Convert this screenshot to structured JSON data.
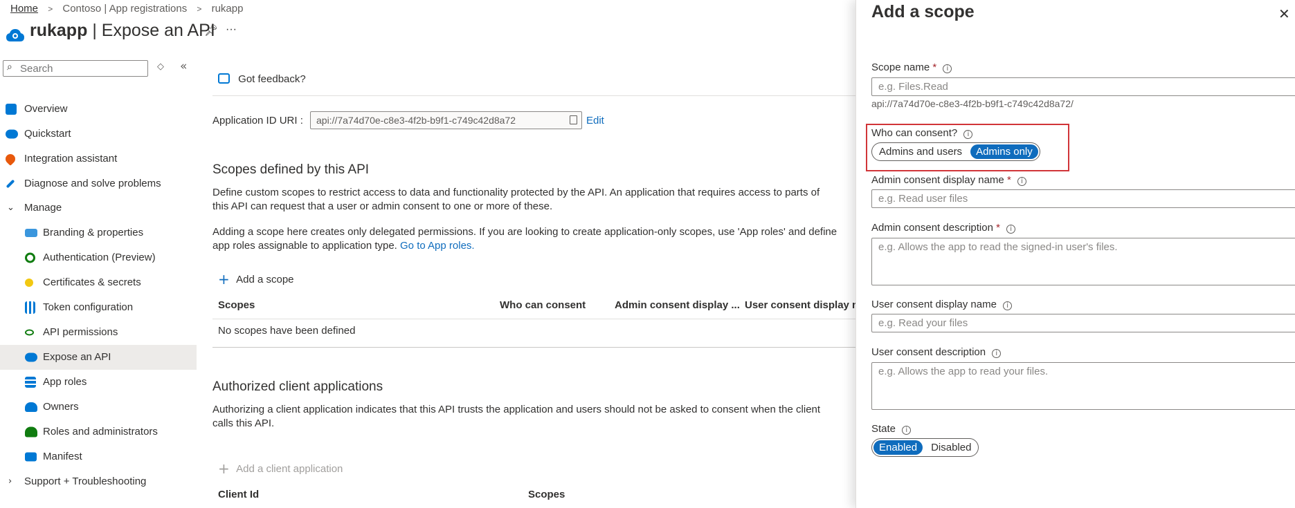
{
  "breadcrumb": {
    "home": "Home",
    "sep": ">",
    "parent": "Contoso | App registrations",
    "current": "rukapp"
  },
  "page": {
    "app_name": "rukapp",
    "divider": "|",
    "title": "Expose an API",
    "more": "···"
  },
  "sidebar": {
    "search_placeholder": "Search",
    "items": [
      {
        "label": "Overview",
        "icon": "overview-icon",
        "color": "#0078d4"
      },
      {
        "label": "Quickstart",
        "icon": "cloud-icon",
        "color": "#0078d4"
      },
      {
        "label": "Integration assistant",
        "icon": "rocket-icon",
        "color": "#e8590c"
      },
      {
        "label": "Diagnose and solve problems",
        "icon": "wrench-icon",
        "color": "#0078d4"
      },
      {
        "label": "Manage",
        "icon": "chevron-down-icon"
      },
      {
        "label": "Branding & properties",
        "icon": "branding-icon",
        "color": "#3a96dd"
      },
      {
        "label": "Authentication (Preview)",
        "icon": "authentication-icon",
        "color": "#107c10"
      },
      {
        "label": "Certificates & secrets",
        "icon": "key-icon",
        "color": "#f2c811"
      },
      {
        "label": "Token configuration",
        "icon": "token-icon",
        "color": "#0078d4"
      },
      {
        "label": "API permissions",
        "icon": "api-permissions-icon",
        "color": "#107c10"
      },
      {
        "label": "Expose an API",
        "icon": "cloud-gear-icon",
        "color": "#0078d4"
      },
      {
        "label": "App roles",
        "icon": "grid-icon",
        "color": "#0078d4"
      },
      {
        "label": "Owners",
        "icon": "people-icon",
        "color": "#0078d4"
      },
      {
        "label": "Roles and administrators",
        "icon": "user-role-icon",
        "color": "#107c10"
      },
      {
        "label": "Manifest",
        "icon": "manifest-icon",
        "color": "#0078d4"
      },
      {
        "label": "Support + Troubleshooting",
        "icon": "chevron-right-icon"
      }
    ]
  },
  "main": {
    "feedback": "Got feedback?",
    "app_id_label": "Application ID URI :",
    "app_id_value": "api://7a74d70e-c8e3-4f2b-b9f1-c749c42d8a72",
    "edit": "Edit",
    "scopes_title": "Scopes defined by this API",
    "scopes_desc": "Define custom scopes to restrict access to data and functionality protected by the API. An application that requires access to parts of this API can request that a user or admin consent to one or more of these.",
    "scopes_note": "Adding a scope here creates only delegated permissions. If you are looking to create application-only scopes, use 'App roles' and define app roles assignable to application type.",
    "go_to_app_roles": "Go to App roles.",
    "add_scope": "Add a scope",
    "columns": [
      "Scopes",
      "Who can consent",
      "Admin consent display ...",
      "User consent display na..."
    ],
    "empty_scopes": "No scopes have been defined",
    "clients_title": "Authorized client applications",
    "clients_desc": "Authorizing a client application indicates that this API trusts the application and users should not be asked to consent when the client calls this API.",
    "add_client": "Add a client application",
    "client_columns": [
      "Client Id",
      "Scopes"
    ]
  },
  "panel": {
    "title": "Add a scope",
    "scope_name_label": "Scope name",
    "scope_name_placeholder": "e.g. Files.Read",
    "scope_uri": "api://7a74d70e-c8e3-4f2b-b9f1-c749c42d8a72/",
    "consent_label": "Who can consent?",
    "consent_options": [
      "Admins and users",
      "Admins only"
    ],
    "consent_selected": "Admins only",
    "admin_display_label": "Admin consent display name",
    "admin_display_placeholder": "e.g. Read user files",
    "admin_desc_label": "Admin consent description",
    "admin_desc_placeholder": "e.g. Allows the app to read the signed-in user's files.",
    "user_display_label": "User consent display name",
    "user_display_placeholder": "e.g. Read your files",
    "user_desc_label": "User consent description",
    "user_desc_placeholder": "e.g. Allows the app to read your files.",
    "state_label": "State",
    "state_options": [
      "Enabled",
      "Disabled"
    ],
    "state_selected": "Enabled",
    "required_mark": "*",
    "info_glyph": "i"
  },
  "colors": {
    "accent": "#0f6cbd",
    "highlight_border": "#d13438",
    "active_nav": "#edebe9"
  }
}
